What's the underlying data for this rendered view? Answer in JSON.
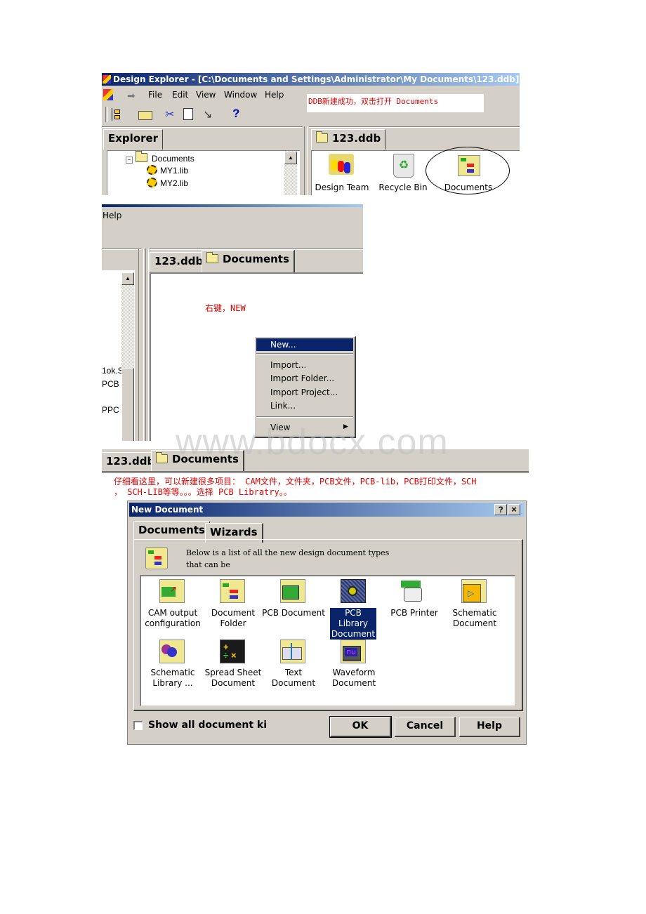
{
  "screen1": {
    "title": "Design Explorer - [C:\\Documents and Settings\\Administrator\\My Documents\\123.ddb]",
    "menu": [
      "File",
      "Edit",
      "View",
      "Window",
      "Help"
    ],
    "annotation": "DDB新建成功，双击打开 Documents",
    "toolbar_icons": [
      "tree-icon",
      "open-folder-icon",
      "cut-icon",
      "paste-icon",
      "wand-icon",
      "help-icon"
    ],
    "toolbar_help_glyph": "?",
    "explorer_tab": "Explorer",
    "tree": [
      {
        "label": "Documents",
        "expander": "⊟"
      },
      {
        "label": "MY1.lib"
      },
      {
        "label": "MY2.lib"
      }
    ],
    "right_tab": "123.ddb",
    "items": [
      {
        "label": "Design Team"
      },
      {
        "label": "Recycle Bin"
      },
      {
        "label": "Documents",
        "circled": true
      }
    ]
  },
  "screen2": {
    "menu_help": "Help",
    "tabs": [
      "123.ddb",
      "Documents"
    ],
    "annotation": "右键，NEW",
    "tree_fragments": [
      "1ok.S",
      "PCB",
      "PPC"
    ],
    "context_menu": {
      "items": [
        {
          "label": "New...",
          "selected": true
        },
        {
          "label": "Import..."
        },
        {
          "label": "Import Folder..."
        },
        {
          "label": "Import Project..."
        },
        {
          "label": "Link..."
        },
        {
          "label": "View",
          "submenu": true
        }
      ]
    }
  },
  "watermark": "www.bdocx.com",
  "screen3": {
    "tabs": [
      "123.ddb",
      "Documents"
    ],
    "annotation_line1": "仔细看这里，可以新建很多项目： CAM文件，文件夹，PCB文件，PCB-lib，PCB打印文件，SCH",
    "annotation_line2": "， SCH-LIB等等。。。选择 PCB Libratry。。",
    "dialog": {
      "title": "New Document",
      "title_buttons": [
        "?",
        "×"
      ],
      "tabs": [
        "Documents",
        "Wizards"
      ],
      "description_line1": "Below is a list of all the new design document types",
      "description_line2": "that can be",
      "documents": [
        {
          "label1": "CAM output",
          "label2": "configuration",
          "icon": "cam-output-icon"
        },
        {
          "label1": "Document",
          "label2": "Folder",
          "icon": "document-folder-icon"
        },
        {
          "label1": "PCB Document",
          "label2": "",
          "icon": "pcb-document-icon"
        },
        {
          "label1": "PCB Library",
          "label2": "Document",
          "icon": "pcb-library-icon",
          "selected": true
        },
        {
          "label1": "PCB Printer",
          "label2": "",
          "icon": "pcb-printer-icon"
        },
        {
          "label1": "Schematic",
          "label2": "Document",
          "icon": "schematic-document-icon"
        },
        {
          "label1": "Schematic",
          "label2": "Library ...",
          "icon": "schematic-library-icon"
        },
        {
          "label1": "Spread Sheet",
          "label2": "Document",
          "icon": "spreadsheet-icon"
        },
        {
          "label1": "Text",
          "label2": "Document",
          "icon": "text-document-icon"
        },
        {
          "label1": "Waveform",
          "label2": "Document",
          "icon": "waveform-icon"
        }
      ],
      "checkbox_label": "Show all document ki",
      "checkbox_checked": false,
      "buttons": {
        "ok": "OK",
        "cancel": "Cancel",
        "help": "Help"
      }
    }
  }
}
